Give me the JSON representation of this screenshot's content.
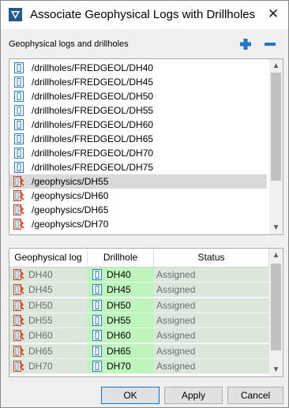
{
  "window": {
    "title": "Associate Geophysical Logs with Drillholes",
    "close_symbol": "✕"
  },
  "section_label": "Geophysical logs and drillholes",
  "list_items": [
    {
      "label": "/drillholes/FREDGEOL/DH40",
      "kind": "drillhole",
      "selected": false
    },
    {
      "label": "/drillholes/FREDGEOL/DH45",
      "kind": "drillhole",
      "selected": false
    },
    {
      "label": "/drillholes/FREDGEOL/DH50",
      "kind": "drillhole",
      "selected": false
    },
    {
      "label": "/drillholes/FREDGEOL/DH55",
      "kind": "drillhole",
      "selected": false
    },
    {
      "label": "/drillholes/FREDGEOL/DH60",
      "kind": "drillhole",
      "selected": false
    },
    {
      "label": "/drillholes/FREDGEOL/DH65",
      "kind": "drillhole",
      "selected": false
    },
    {
      "label": "/drillholes/FREDGEOL/DH70",
      "kind": "drillhole",
      "selected": false
    },
    {
      "label": "/drillholes/FREDGEOL/DH75",
      "kind": "drillhole",
      "selected": false
    },
    {
      "label": "/geophysics/DH55",
      "kind": "geophysics",
      "selected": true
    },
    {
      "label": "/geophysics/DH60",
      "kind": "geophysics",
      "selected": false
    },
    {
      "label": "/geophysics/DH65",
      "kind": "geophysics",
      "selected": false
    },
    {
      "label": "/geophysics/DH70",
      "kind": "geophysics",
      "selected": false
    }
  ],
  "table": {
    "columns": [
      "Geophysical log",
      "Drillhole",
      "Status"
    ],
    "rows": [
      {
        "log": "DH40",
        "drillhole": "DH40",
        "status": "Assigned"
      },
      {
        "log": "DH45",
        "drillhole": "DH45",
        "status": "Assigned"
      },
      {
        "log": "DH50",
        "drillhole": "DH50",
        "status": "Assigned"
      },
      {
        "log": "DH55",
        "drillhole": "DH55",
        "status": "Assigned"
      },
      {
        "log": "DH60",
        "drillhole": "DH60",
        "status": "Assigned"
      },
      {
        "log": "DH65",
        "drillhole": "DH65",
        "status": "Assigned"
      },
      {
        "log": "DH70",
        "drillhole": "DH70",
        "status": "Assigned"
      }
    ]
  },
  "buttons": {
    "ok": "OK",
    "apply": "Apply",
    "cancel": "Cancel"
  },
  "icons": {
    "app": "app-logo-icon",
    "add": "plus-icon",
    "remove": "minus-icon",
    "drillhole": "drillhole-icon",
    "geophysics": "geophysics-log-icon"
  },
  "colors": {
    "accent_blue": "#1f5c8b",
    "drillhole_icon": "#2a7bc2",
    "geophysics_icon": "#d4441c",
    "assigned_row": "#dce7dc",
    "drillhole_cell": "#bdf5bd",
    "selected_row": "#d9d9d9"
  }
}
